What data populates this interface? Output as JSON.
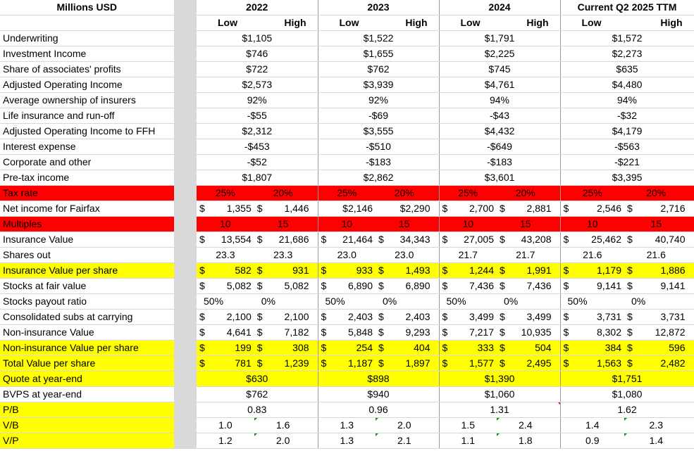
{
  "header": {
    "label": "Millions USD",
    "years": [
      "2022",
      "2023",
      "2024",
      "Current Q2 2025 TTM"
    ],
    "low": "Low",
    "high": "High"
  },
  "rows": [
    {
      "label": "Underwriting",
      "style": "plain",
      "kind": "single",
      "vals": [
        "$1,105",
        "$1,522",
        "$1,791",
        "$1,572"
      ]
    },
    {
      "label": "Investment Income",
      "style": "plain",
      "kind": "single",
      "vals": [
        "$746",
        "$1,655",
        "$2,225",
        "$2,273"
      ]
    },
    {
      "label": "Share of associates' profits",
      "style": "plain",
      "kind": "single",
      "vals": [
        "$722",
        "$762",
        "$745",
        "$635"
      ]
    },
    {
      "label": "Adjusted Operating Income",
      "style": "plain",
      "kind": "single",
      "vals": [
        "$2,573",
        "$3,939",
        "$4,761",
        "$4,480"
      ]
    },
    {
      "label": "Average ownership of insurers",
      "style": "plain",
      "kind": "single",
      "vals": [
        "92%",
        "92%",
        "94%",
        "94%"
      ]
    },
    {
      "label": "Life insurance and run-off",
      "style": "plain",
      "kind": "single",
      "vals": [
        "-$55",
        "-$69",
        "-$43",
        "-$32"
      ]
    },
    {
      "label": "Adjusted Operating Income to FFH",
      "style": "plain",
      "kind": "single",
      "vals": [
        "$2,312",
        "$3,555",
        "$4,432",
        "$4,179"
      ]
    },
    {
      "label": "Interest expense",
      "style": "plain",
      "kind": "single",
      "vals": [
        "-$453",
        "-$510",
        "-$649",
        "-$563"
      ]
    },
    {
      "label": "Corporate and other",
      "style": "plain",
      "kind": "single",
      "vals": [
        "-$52",
        "-$183",
        "-$183",
        "-$221"
      ]
    },
    {
      "label": "Pre-tax income",
      "style": "plain",
      "kind": "single",
      "vals": [
        "$1,807",
        "$2,862",
        "$3,601",
        "$3,395"
      ]
    },
    {
      "label": "Tax rate",
      "style": "red",
      "kind": "pairplain",
      "vals": [
        [
          "25%",
          "20%"
        ],
        [
          "25%",
          "20%"
        ],
        [
          "25%",
          "20%"
        ],
        [
          "25%",
          "20%"
        ]
      ]
    },
    {
      "label": "Net income for Fairfax",
      "style": "plain",
      "kind": "pairmix",
      "vals": [
        [
          [
            "$",
            "1,355"
          ],
          [
            "$",
            "1,446"
          ]
        ],
        [
          [
            "",
            "$2,146"
          ],
          [
            "",
            "$2,290"
          ]
        ],
        [
          [
            "$",
            "2,700"
          ],
          [
            "$",
            "2,881"
          ]
        ],
        [
          [
            "$",
            "2,546"
          ],
          [
            "$",
            "2,716"
          ]
        ]
      ]
    },
    {
      "label": "Multiples",
      "style": "red",
      "kind": "pairplain",
      "vals": [
        [
          "10",
          "15"
        ],
        [
          "10",
          "15"
        ],
        [
          "10",
          "15"
        ],
        [
          "10",
          "15"
        ]
      ]
    },
    {
      "label": "Insurance Value",
      "style": "plain",
      "kind": "pair",
      "vals": [
        [
          [
            "$",
            "13,554"
          ],
          [
            "$",
            "21,686"
          ]
        ],
        [
          [
            "$",
            "21,464"
          ],
          [
            "$",
            "34,343"
          ]
        ],
        [
          [
            "$",
            "27,005"
          ],
          [
            "$",
            "43,208"
          ]
        ],
        [
          [
            "$",
            "25,462"
          ],
          [
            "$",
            "40,740"
          ]
        ]
      ]
    },
    {
      "label": "Shares out",
      "style": "plain",
      "kind": "pairplain",
      "vals": [
        [
          "23.3",
          "23.3"
        ],
        [
          "23.0",
          "23.0"
        ],
        [
          "21.7",
          "21.7"
        ],
        [
          "21.6",
          "21.6"
        ]
      ]
    },
    {
      "label": "Insurance Value per share",
      "style": "yellow",
      "kind": "pair",
      "vals": [
        [
          [
            "$",
            "582"
          ],
          [
            "$",
            "931"
          ]
        ],
        [
          [
            "$",
            "933"
          ],
          [
            "$",
            "1,493"
          ]
        ],
        [
          [
            "$",
            "1,244"
          ],
          [
            "$",
            "1,991"
          ]
        ],
        [
          [
            "$",
            "1,179"
          ],
          [
            "$",
            "1,886"
          ]
        ]
      ]
    },
    {
      "label": "Stocks at fair value",
      "style": "plain",
      "kind": "pair",
      "vals": [
        [
          [
            "$",
            "5,082"
          ],
          [
            "$",
            "5,082"
          ]
        ],
        [
          [
            "$",
            "6,890"
          ],
          [
            "$",
            "6,890"
          ]
        ],
        [
          [
            "$",
            "7,436"
          ],
          [
            "$",
            "7,436"
          ]
        ],
        [
          [
            "$",
            "9,141"
          ],
          [
            "$",
            "9,141"
          ]
        ]
      ]
    },
    {
      "label": "Stocks payout ratio",
      "style": "plain",
      "kind": "pairleft",
      "vals": [
        [
          "50%",
          "0%"
        ],
        [
          "50%",
          "0%"
        ],
        [
          "50%",
          "0%"
        ],
        [
          "50%",
          "0%"
        ]
      ]
    },
    {
      "label": "Consolidated subs at carrying",
      "style": "plain",
      "kind": "pair",
      "vals": [
        [
          [
            "$",
            "2,100"
          ],
          [
            "$",
            "2,100"
          ]
        ],
        [
          [
            "$",
            "2,403"
          ],
          [
            "$",
            "2,403"
          ]
        ],
        [
          [
            "$",
            "3,499"
          ],
          [
            "$",
            "3,499"
          ]
        ],
        [
          [
            "$",
            "3,731"
          ],
          [
            "$",
            "3,731"
          ]
        ]
      ]
    },
    {
      "label": "Non-insurance Value",
      "style": "plain",
      "kind": "pair",
      "vals": [
        [
          [
            "$",
            "4,641"
          ],
          [
            "$",
            "7,182"
          ]
        ],
        [
          [
            "$",
            "5,848"
          ],
          [
            "$",
            "9,293"
          ]
        ],
        [
          [
            "$",
            "7,217"
          ],
          [
            "$",
            "10,935"
          ]
        ],
        [
          [
            "$",
            "8,302"
          ],
          [
            "$",
            "12,872"
          ]
        ]
      ]
    },
    {
      "label": "Non-insurance Value per share",
      "style": "yellow",
      "kind": "pair",
      "vals": [
        [
          [
            "$",
            "199"
          ],
          [
            "$",
            "308"
          ]
        ],
        [
          [
            "$",
            "254"
          ],
          [
            "$",
            "404"
          ]
        ],
        [
          [
            "$",
            "333"
          ],
          [
            "$",
            "504"
          ]
        ],
        [
          [
            "$",
            "384"
          ],
          [
            "$",
            "596"
          ]
        ]
      ]
    },
    {
      "label": "Total Value per share",
      "style": "yellow",
      "kind": "pair",
      "vals": [
        [
          [
            "$",
            "781"
          ],
          [
            "$",
            "1,239"
          ]
        ],
        [
          [
            "$",
            "1,187"
          ],
          [
            "$",
            "1,897"
          ]
        ],
        [
          [
            "$",
            "1,577"
          ],
          [
            "$",
            "2,495"
          ]
        ],
        [
          [
            "$",
            "1,563"
          ],
          [
            "$",
            "2,482"
          ]
        ]
      ]
    },
    {
      "label": "Quote at year-end",
      "style": "yellow",
      "kind": "single",
      "vals": [
        "$630",
        "$898",
        "$1,390",
        "$1,751"
      ]
    },
    {
      "label": "BVPS at year-end",
      "style": "plain",
      "kind": "single",
      "vals": [
        "$762",
        "$940",
        "$1,060",
        "$1,080"
      ]
    },
    {
      "label": "P/B",
      "style": "ylabel",
      "kind": "single",
      "vals": [
        "0.83",
        "0.96",
        "1.31",
        "1.62"
      ]
    },
    {
      "label": "V/B",
      "style": "ylabel",
      "kind": "pairplain",
      "vals": [
        [
          "1.0",
          "1.6"
        ],
        [
          "1.3",
          "2.0"
        ],
        [
          "1.5",
          "2.4"
        ],
        [
          "1.4",
          "2.3"
        ]
      ]
    },
    {
      "label": "V/P",
      "style": "ylabel",
      "kind": "pairplain",
      "vals": [
        [
          "1.2",
          "2.0"
        ],
        [
          "1.3",
          "2.1"
        ],
        [
          "1.1",
          "1.8"
        ],
        [
          "0.9",
          "1.4"
        ]
      ]
    }
  ]
}
